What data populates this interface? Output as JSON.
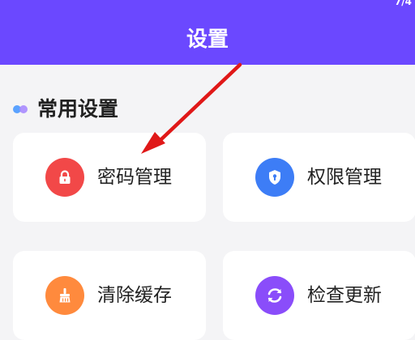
{
  "header": {
    "title": "设置",
    "status_fragment": "7/4"
  },
  "section": {
    "title": "常用设置"
  },
  "cards": [
    {
      "label": "密码管理",
      "icon": "lock-icon",
      "color": "#f24848"
    },
    {
      "label": "权限管理",
      "icon": "shield-icon",
      "color": "#3d7df6"
    },
    {
      "label": "清除缓存",
      "icon": "broom-icon",
      "color": "#ff8a3d"
    },
    {
      "label": "检查更新",
      "icon": "refresh-icon",
      "color": "#8a4dfa"
    }
  ],
  "colors": {
    "header_bg": "#6b48ff",
    "page_bg": "#f4f4f6",
    "annotation_arrow": "#e01818"
  }
}
